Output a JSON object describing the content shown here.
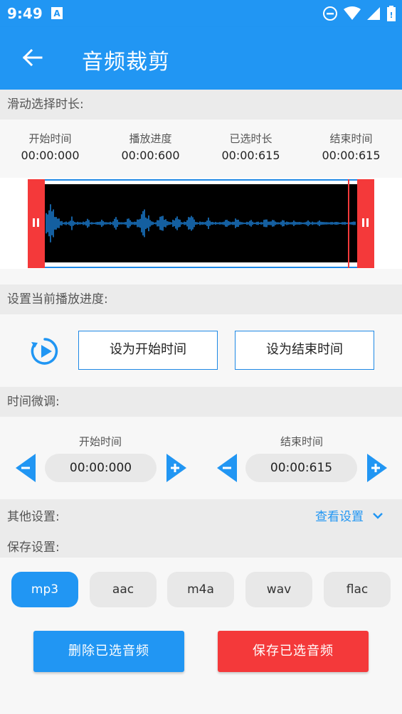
{
  "status_bar": {
    "time": "9:49"
  },
  "app_bar": {
    "title": "音频裁剪"
  },
  "sections": {
    "slide_select": "滑动选择时长:",
    "set_progress": "设置当前播放进度:",
    "fine_tune": "时间微调:",
    "other_settings": "其他设置:",
    "save_settings": "保存设置:"
  },
  "info": [
    {
      "label": "开始时间",
      "value": "00:00:000"
    },
    {
      "label": "播放进度",
      "value": "00:00:600"
    },
    {
      "label": "已选时长",
      "value": "00:00:615"
    },
    {
      "label": "结束时间",
      "value": "00:00:615"
    }
  ],
  "buttons": {
    "set_start": "设为开始时间",
    "set_end": "设为结束时间",
    "view_settings": "查看设置",
    "delete_selected": "删除已选音频",
    "save_selected": "保存已选音频"
  },
  "fine_tune": {
    "start_label": "开始时间",
    "start_value": "00:00:000",
    "end_label": "结束时间",
    "end_value": "00:00:615"
  },
  "formats": [
    "mp3",
    "aac",
    "m4a",
    "wav",
    "flac"
  ],
  "selected_format": "mp3",
  "colors": {
    "primary": "#2196f3",
    "accent_red": "#f4393a",
    "waveform": "#1e88e5"
  }
}
